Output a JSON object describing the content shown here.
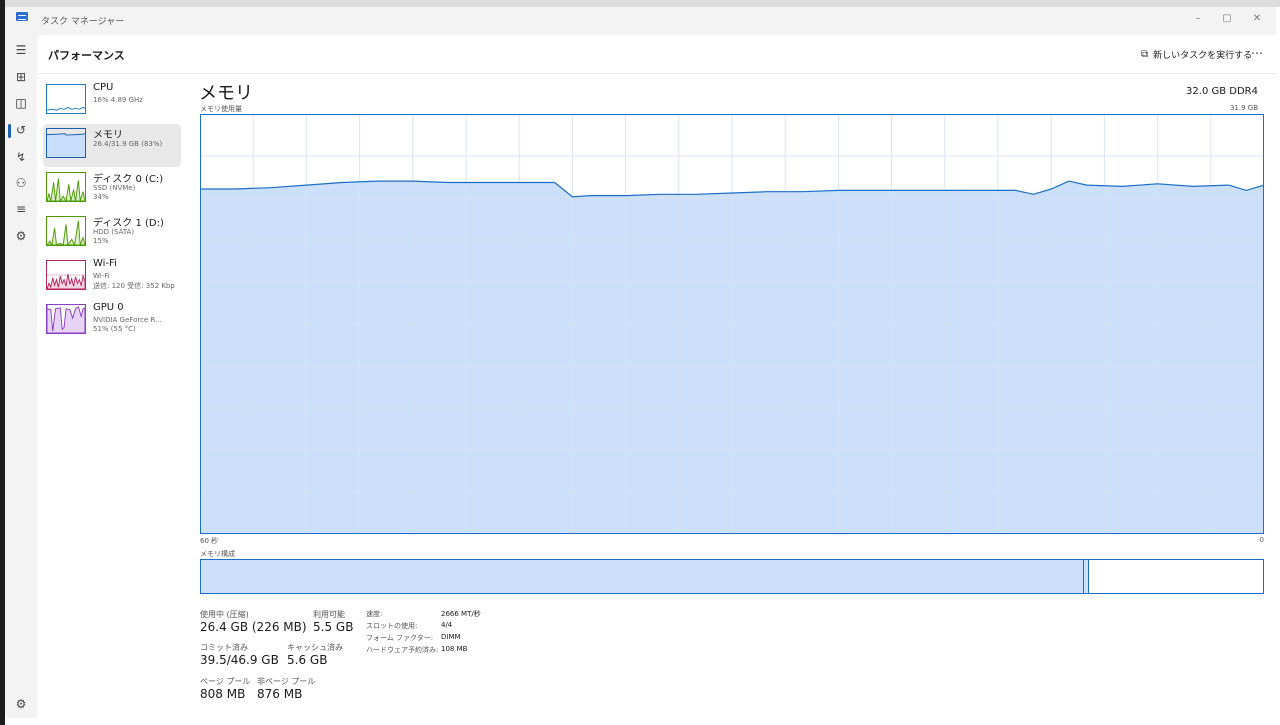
{
  "window": {
    "title": "タスク マネージャー",
    "minimize": "–",
    "maximize": "▢",
    "close": "✕"
  },
  "rail": {
    "items": [
      {
        "icon": "hamburger-menu-icon",
        "glyph": "☰"
      },
      {
        "icon": "processes-icon",
        "glyph": "⊞"
      },
      {
        "icon": "performance-icon",
        "glyph": "◫"
      },
      {
        "icon": "app-history-icon",
        "glyph": "↺"
      },
      {
        "icon": "startup-apps-icon",
        "glyph": "↯"
      },
      {
        "icon": "users-icon",
        "glyph": "⚇"
      },
      {
        "icon": "details-icon",
        "glyph": "≡"
      },
      {
        "icon": "services-icon",
        "glyph": "⚙"
      }
    ],
    "settings_glyph": "⚙"
  },
  "header": {
    "title": "パフォーマンス",
    "new_task_label": "新しいタスクを実行する",
    "more": "⋯"
  },
  "resources": [
    {
      "name": "CPU",
      "line1": "16% 4.89 GHz",
      "line2": "",
      "line3": "",
      "color": "#1a7fc1",
      "fill": "#ffffff"
    },
    {
      "name": "メモリ",
      "line1": "26.4/31.9 GB (83%)",
      "line2": "",
      "line3": "",
      "color": "#1a5fb4",
      "fill": "#c9defa"
    },
    {
      "name": "ディスク 0 (C:)",
      "line1": "SSD (NVMe)",
      "line2": "34%",
      "line3": "",
      "color": "#4e9a06",
      "fill": "#d9efc5"
    },
    {
      "name": "ディスク 1 (D:)",
      "line1": "HDD (SATA)",
      "line2": "15%",
      "line3": "",
      "color": "#4e9a06",
      "fill": "#d9efc5"
    },
    {
      "name": "Wi-Fi",
      "line1": "Wi-Fi",
      "line2": "送信: 120 受信: 352 Kbp",
      "line3": "",
      "color": "#b5245c",
      "fill": "#f7d6e2"
    },
    {
      "name": "GPU 0",
      "line1": "NVIDIA GeForce R...",
      "line2": "51% (55 °C)",
      "line3": "",
      "color": "#8a3fc7",
      "fill": "#e6d3f6"
    }
  ],
  "main": {
    "title": "メモリ",
    "spec": "32.0 GB DDR4",
    "usage_label": "メモリ使用量",
    "usage_max": "31.9 GB",
    "axis_left": "60 秒",
    "axis_right": "0",
    "composition_label": "メモリ構成",
    "accent": "#1a6fc9",
    "fill": "#cce0fb"
  },
  "chart_data": {
    "type": "area",
    "ylim": [
      0,
      31.9
    ],
    "ylabel": "メモリ使用量",
    "grid": true,
    "x": [
      60,
      58,
      56,
      54,
      52,
      50,
      48,
      46,
      44,
      42,
      40,
      39,
      38,
      36,
      34,
      32,
      30,
      28,
      26,
      24,
      22,
      20,
      18,
      16,
      14,
      13,
      12,
      11,
      10,
      8,
      6,
      4,
      2,
      1,
      0
    ],
    "series": [
      {
        "values": [
          26.2,
          26.2,
          26.3,
          26.5,
          26.7,
          26.8,
          26.8,
          26.7,
          26.7,
          26.7,
          26.7,
          25.6,
          25.7,
          25.7,
          25.8,
          25.8,
          25.9,
          26.0,
          26.0,
          26.1,
          26.1,
          26.1,
          26.1,
          26.1,
          26.1,
          25.8,
          26.2,
          26.8,
          26.5,
          26.4,
          26.6,
          26.4,
          26.5,
          26.1,
          26.5
        ]
      }
    ]
  },
  "composition": {
    "in_use_fraction": 0.83,
    "modified_fraction": 0.005
  },
  "stats": {
    "in_use_label": "使用中 (圧縮)",
    "in_use_value": "26.4 GB (226 MB)",
    "available_label": "利用可能",
    "available_value": "5.5 GB",
    "committed_label": "コミット済み",
    "committed_value": "39.5/46.9 GB",
    "cached_label": "キャッシュ済み",
    "cached_value": "5.6 GB",
    "paged_label": "ページ プール",
    "paged_value": "808 MB",
    "nonpaged_label": "非ページ プール",
    "nonpaged_value": "876 MB",
    "speed_label": "速度:",
    "speed_value": "2666 MT/秒",
    "slots_label": "スロットの使用:",
    "slots_value": "4/4",
    "form_label": "フォーム ファクター:",
    "form_value": "DIMM",
    "reserved_label": "ハードウェア予約済み:",
    "reserved_value": "108 MB"
  }
}
